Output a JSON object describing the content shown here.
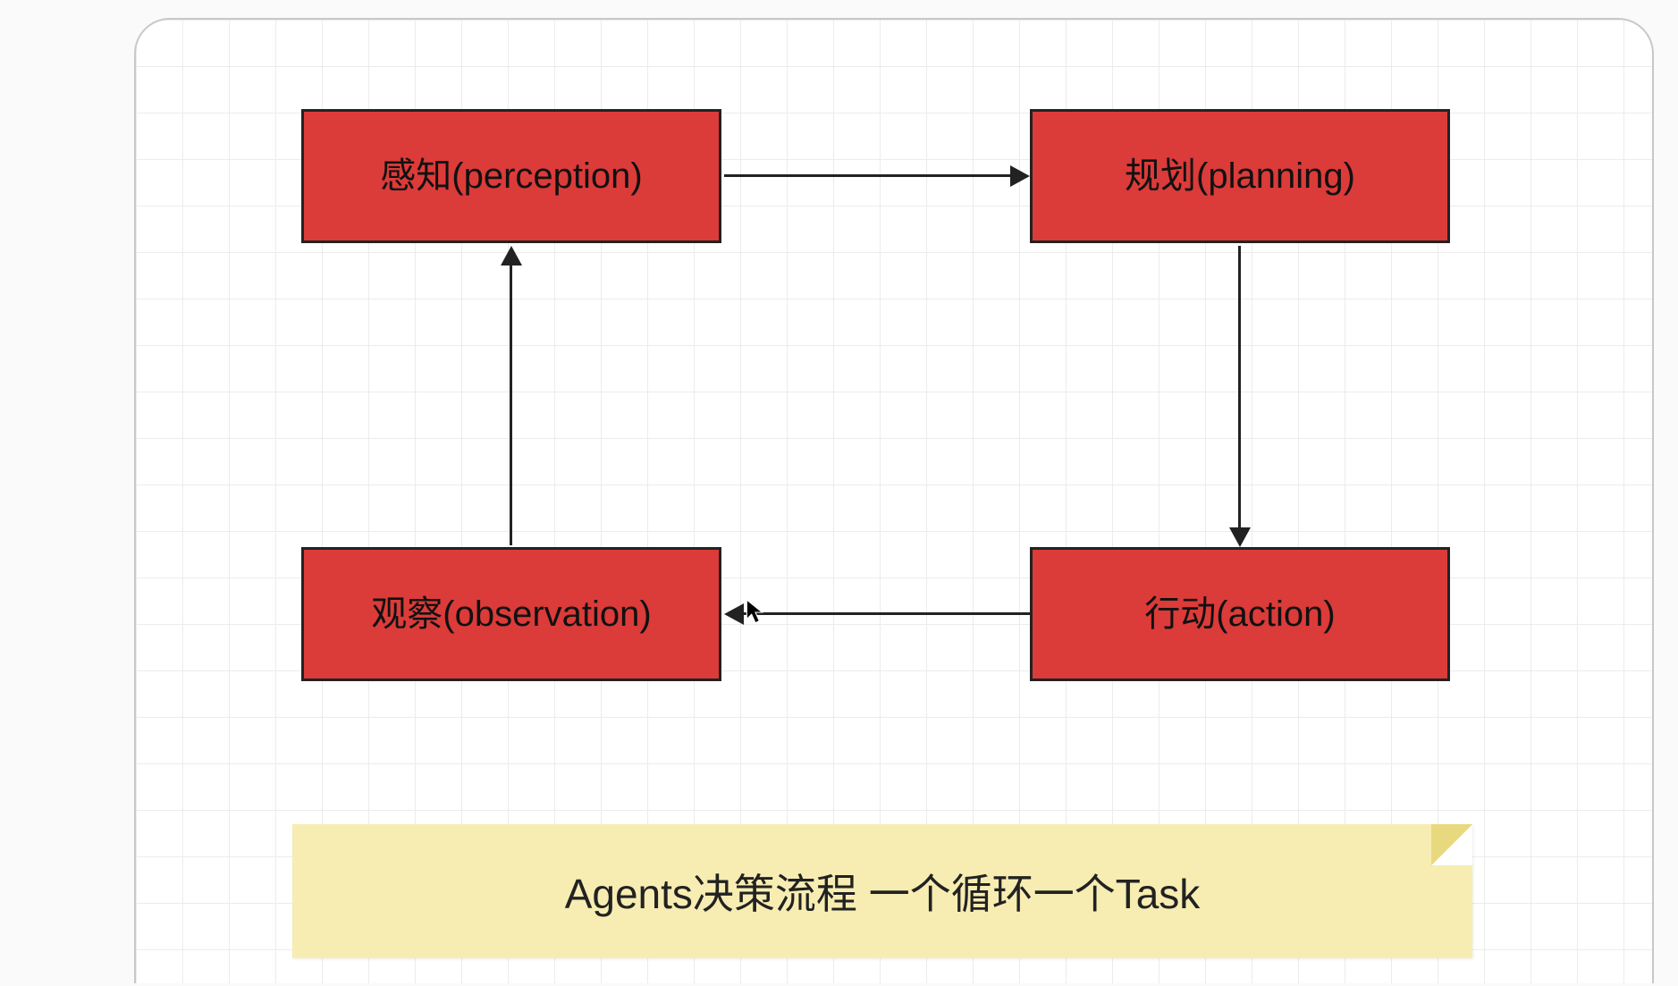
{
  "diagram": {
    "nodes": {
      "perception": "感知(perception)",
      "planning": "规划(planning)",
      "observation": "观察(observation)",
      "action": "行动(action)"
    },
    "arrows": [
      {
        "from": "perception",
        "to": "planning"
      },
      {
        "from": "planning",
        "to": "action"
      },
      {
        "from": "action",
        "to": "observation"
      },
      {
        "from": "observation",
        "to": "perception"
      }
    ],
    "note": "Agents决策流程  一个循环一个Task",
    "colors": {
      "box": "#db3b39",
      "note": "#f7edb2",
      "stroke": "#222222"
    }
  }
}
